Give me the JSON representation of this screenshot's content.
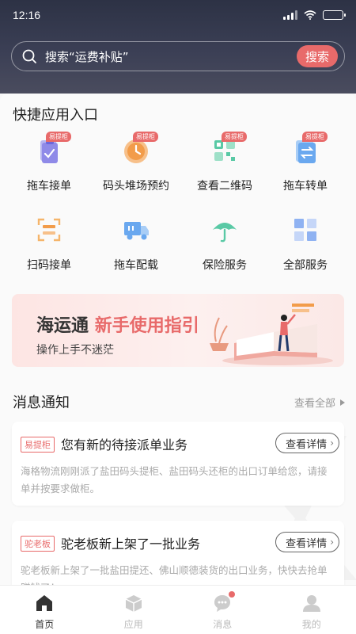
{
  "status_bar": {
    "time": "12:16",
    "battery_level": 1.0
  },
  "search": {
    "placeholder_text": "搜索“运费补贴”",
    "button_label": "搜索"
  },
  "quick_apps": {
    "title": "快捷应用入口",
    "items": [
      {
        "label": "拖车接单",
        "icon": "clipboard-check-icon",
        "badge": "易提柜"
      },
      {
        "label": "码头堆场预约",
        "icon": "clock-icon",
        "badge": "易提柜"
      },
      {
        "label": "查看二维码",
        "icon": "qr-code-icon",
        "badge": "易提柜"
      },
      {
        "label": "拖车转单",
        "icon": "transfer-icon",
        "badge": "易提柜"
      },
      {
        "label": "扫码接单",
        "icon": "scan-icon",
        "badge": ""
      },
      {
        "label": "拖车配载",
        "icon": "truck-icon",
        "badge": ""
      },
      {
        "label": "保险服务",
        "icon": "umbrella-icon",
        "badge": ""
      },
      {
        "label": "全部服务",
        "icon": "grid-icon",
        "badge": ""
      }
    ]
  },
  "banner": {
    "title_main": "海运通",
    "title_highlight": "新手使用指引",
    "subtitle": "操作上手不迷茫"
  },
  "messages": {
    "title": "消息通知",
    "view_all": "查看全部",
    "items": [
      {
        "tag": "易提柜",
        "title": "您有新的待接派单业务",
        "button": "查看详情",
        "body": "海格物流刚刚派了盐田码头提柜、盐田码头还柜的出口订单给您，请接单并按要求做柜。"
      },
      {
        "tag": "驼老板",
        "title": "驼老板新上架了一批业务",
        "button": "查看详情",
        "body": "驼老板新上架了一批盐田提还、佛山顺德装货的出口业务，快快去抢单赚钱了！"
      }
    ]
  },
  "tabbar": {
    "tabs": [
      {
        "label": "首页",
        "icon": "home-icon",
        "active": true
      },
      {
        "label": "应用",
        "icon": "box-icon",
        "active": false
      },
      {
        "label": "消息",
        "icon": "chat-icon",
        "active": false,
        "has_dot": true
      },
      {
        "label": "我的",
        "icon": "user-icon",
        "active": false
      }
    ]
  },
  "colors": {
    "accent": "#e86a6a",
    "header_bg": "#2d3245"
  }
}
